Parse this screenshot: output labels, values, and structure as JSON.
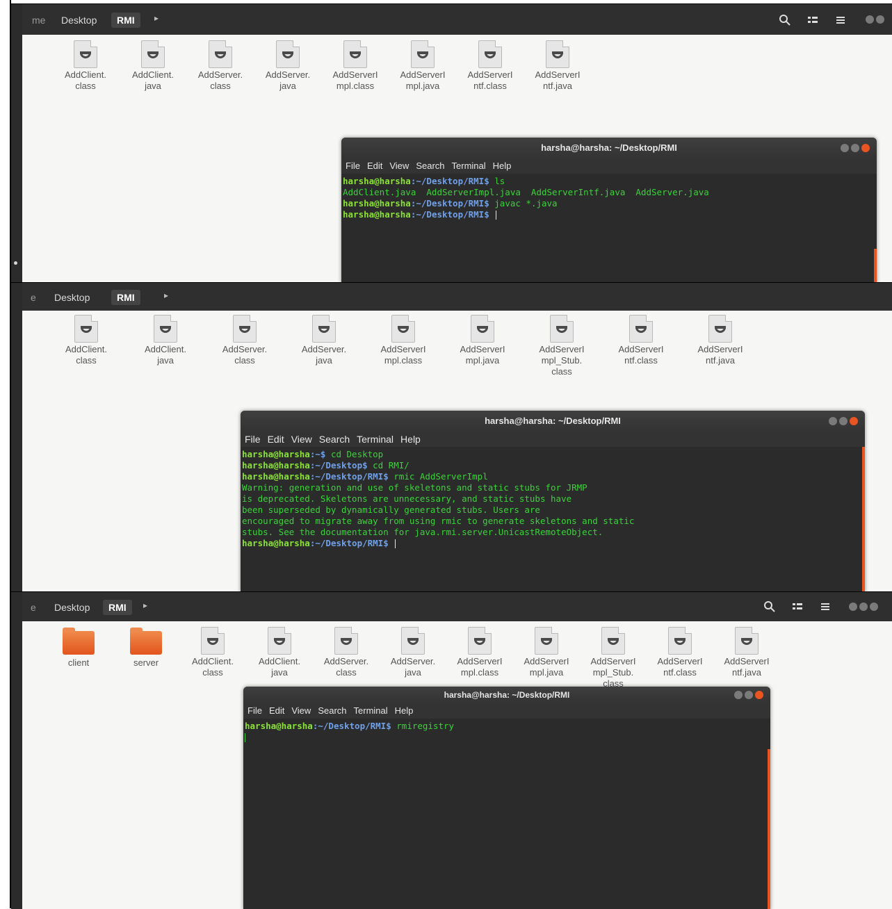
{
  "panels": [
    {
      "breadcrumb": {
        "prev": "me",
        "items": [
          "Desktop",
          "RMI"
        ]
      },
      "files": [
        {
          "line1": "AddClient.",
          "line2": "class"
        },
        {
          "line1": "AddClient.",
          "line2": "java"
        },
        {
          "line1": "AddServer.",
          "line2": "class"
        },
        {
          "line1": "AddServer.",
          "line2": "java"
        },
        {
          "line1": "AddServerI",
          "line2": "mpl.class"
        },
        {
          "line1": "AddServerI",
          "line2": "mpl.java"
        },
        {
          "line1": "AddServerI",
          "line2": "ntf.class"
        },
        {
          "line1": "AddServerI",
          "line2": "ntf.java"
        }
      ],
      "terminal": {
        "title": "harsha@harsha: ~/Desktop/RMI",
        "menu": [
          "File",
          "Edit",
          "View",
          "Search",
          "Terminal",
          "Help"
        ],
        "lines": [
          {
            "user": "harsha@harsha",
            "path": ":~/Desktop/RMI$ ",
            "cmd": "ls"
          },
          {
            "out": "AddClient.java  AddServerImpl.java  AddServerIntf.java  AddServer.java"
          },
          {
            "user": "harsha@harsha",
            "path": ":~/Desktop/RMI$ ",
            "cmd": "javac *.java"
          },
          {
            "user": "harsha@harsha",
            "path": ":~/Desktop/RMI$ ",
            "cmd": "",
            "cursor": true
          }
        ]
      }
    },
    {
      "breadcrumb": {
        "prev": "e",
        "items": [
          "Desktop",
          "RMI"
        ]
      },
      "files": [
        {
          "line1": "AddClient.",
          "line2": "class"
        },
        {
          "line1": "AddClient.",
          "line2": "java"
        },
        {
          "line1": "AddServer.",
          "line2": "class"
        },
        {
          "line1": "AddServer.",
          "line2": "java"
        },
        {
          "line1": "AddServerI",
          "line2": "mpl.class"
        },
        {
          "line1": "AddServerI",
          "line2": "mpl.java"
        },
        {
          "line1": "AddServerI",
          "line2": "mpl_Stub.",
          "line3": "class"
        },
        {
          "line1": "AddServerI",
          "line2": "ntf.class"
        },
        {
          "line1": "AddServerI",
          "line2": "ntf.java"
        }
      ],
      "terminal": {
        "title": "harsha@harsha: ~/Desktop/RMI",
        "menu": [
          "File",
          "Edit",
          "View",
          "Search",
          "Terminal",
          "Help"
        ],
        "lines": [
          {
            "user": "harsha@harsha",
            "path": ":~$ ",
            "cmd": "cd Desktop"
          },
          {
            "user": "harsha@harsha",
            "path": ":~/Desktop$ ",
            "cmd": "cd RMI/"
          },
          {
            "user": "harsha@harsha",
            "path": ":~/Desktop/RMI$ ",
            "cmd": "rmic AddServerImpl"
          },
          {
            "out": "Warning: generation and use of skeletons and static stubs for JRMP"
          },
          {
            "out": "is deprecated. Skeletons are unnecessary, and static stubs have"
          },
          {
            "out": "been superseded by dynamically generated stubs. Users are"
          },
          {
            "out": "encouraged to migrate away from using rmic to generate skeletons and static"
          },
          {
            "out": "stubs. See the documentation for java.rmi.server.UnicastRemoteObject."
          },
          {
            "user": "harsha@harsha",
            "path": ":~/Desktop/RMI$ ",
            "cmd": "",
            "cursor": true
          }
        ]
      }
    },
    {
      "breadcrumb": {
        "prev": "e",
        "items": [
          "Desktop",
          "RMI"
        ]
      },
      "files": [
        {
          "folder": true,
          "line1": "client"
        },
        {
          "folder": true,
          "line1": "server"
        },
        {
          "line1": "AddClient.",
          "line2": "class"
        },
        {
          "line1": "AddClient.",
          "line2": "java"
        },
        {
          "line1": "AddServer.",
          "line2": "class"
        },
        {
          "line1": "AddServer.",
          "line2": "java"
        },
        {
          "line1": "AddServerI",
          "line2": "mpl.class"
        },
        {
          "line1": "AddServerI",
          "line2": "mpl.java"
        },
        {
          "line1": "AddServerI",
          "line2": "mpl_Stub.",
          "line3": "class"
        },
        {
          "line1": "AddServerI",
          "line2": "ntf.class"
        },
        {
          "line1": "AddServerI",
          "line2": "ntf.java"
        }
      ],
      "terminal": {
        "title": "harsha@harsha: ~/Desktop/RMI",
        "menu": [
          "File",
          "Edit",
          "View",
          "Search",
          "Terminal",
          "Help"
        ],
        "lines": [
          {
            "user": "harsha@harsha",
            "path": ":~/Desktop/RMI$ ",
            "cmd": "rmiregistry"
          }
        ]
      }
    }
  ]
}
